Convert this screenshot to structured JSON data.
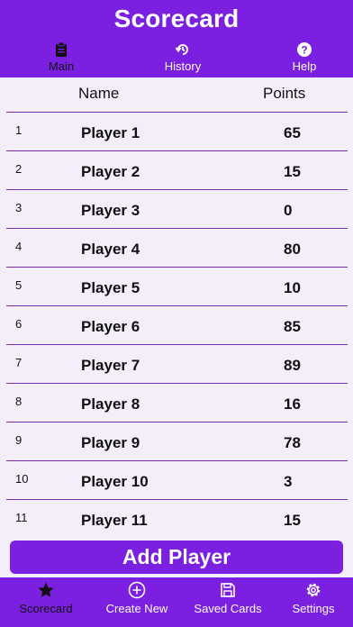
{
  "header": {
    "title": "Scorecard",
    "tabs": [
      {
        "label": "Main",
        "icon": "clipboard-icon"
      },
      {
        "label": "History",
        "icon": "history-icon"
      },
      {
        "label": "Help",
        "icon": "help-icon"
      }
    ]
  },
  "table": {
    "columns": [
      "Name",
      "Points"
    ],
    "rows": [
      {
        "index": "1",
        "name": "Player 1",
        "points": "65"
      },
      {
        "index": "2",
        "name": "Player 2",
        "points": "15"
      },
      {
        "index": "3",
        "name": "Player 3",
        "points": "0"
      },
      {
        "index": "4",
        "name": "Player 4",
        "points": "80"
      },
      {
        "index": "5",
        "name": "Player 5",
        "points": "10"
      },
      {
        "index": "6",
        "name": "Player 6",
        "points": "85"
      },
      {
        "index": "7",
        "name": "Player 7",
        "points": "89"
      },
      {
        "index": "8",
        "name": "Player 8",
        "points": "16"
      },
      {
        "index": "9",
        "name": "Player 9",
        "points": "78"
      },
      {
        "index": "10",
        "name": "Player 10",
        "points": "3"
      },
      {
        "index": "11",
        "name": "Player 11",
        "points": "15"
      }
    ]
  },
  "actions": {
    "add_player": "Add Player"
  },
  "bottom_nav": {
    "tabs": [
      {
        "label": "Scorecard",
        "icon": "star-icon"
      },
      {
        "label": "Create New",
        "icon": "plus-circle-icon"
      },
      {
        "label": "Saved Cards",
        "icon": "save-icon"
      },
      {
        "label": "Settings",
        "icon": "gear-icon"
      }
    ]
  },
  "colors": {
    "accent": "#7b1fe0",
    "background": "#f4eefb",
    "divider": "#7b2fb0"
  }
}
